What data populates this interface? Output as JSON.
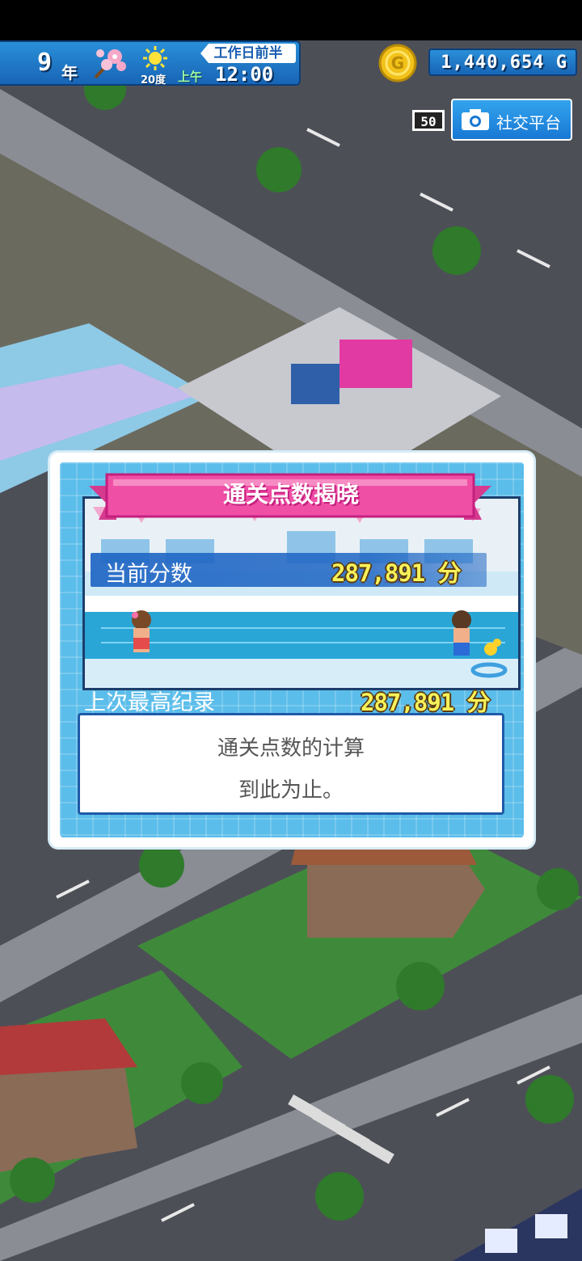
{
  "hud": {
    "year": "9",
    "year_unit": "年",
    "season_icon": "cherry-blossom-icon",
    "weather_icon": "sun-icon",
    "temperature": "20度",
    "period": "工作日前半",
    "ampm": "上午",
    "time": "12:00",
    "money": "1,440,654 G",
    "coin_icon": "coin-icon"
  },
  "social": {
    "level": "50",
    "label": "社交平台",
    "icon": "camera-icon"
  },
  "dialog": {
    "title": "通关点数揭晓",
    "current_score_label": "当前分数",
    "current_score_value": "287,891 分",
    "best_record_label": "上次最高纪录",
    "best_record_value": "287,891 分",
    "message_line1": "通关点数的计算",
    "message_line2": "到此为止。"
  },
  "colors": {
    "hud_blue": "#1f7acb",
    "dialog_blue": "#5bbdea",
    "ribbon_pink": "#f04fa6",
    "score_yellow": "#f7f25a"
  }
}
